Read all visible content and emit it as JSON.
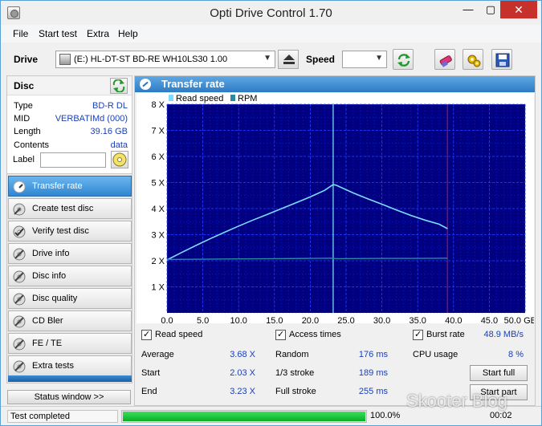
{
  "window": {
    "title": "Opti Drive Control 1.70",
    "minimize": "—",
    "maximize": "▢",
    "close": "✕"
  },
  "menu": [
    "File",
    "Start test",
    "Extra",
    "Help"
  ],
  "toolbar": {
    "drive_label": "Drive",
    "drive_value": "(E:)  HL-DT-ST BD-RE  WH10LS30 1.00",
    "speed_label": "Speed",
    "speed_value": ""
  },
  "disc": {
    "title": "Disc",
    "rows": [
      {
        "key": "Type",
        "value": "BD-R DL"
      },
      {
        "key": "MID",
        "value": "VERBATIMd (000)"
      },
      {
        "key": "Length",
        "value": "39.16 GB"
      },
      {
        "key": "Contents",
        "value": "data"
      }
    ],
    "label_key": "Label",
    "label_value": ""
  },
  "nav": {
    "items": [
      "Transfer rate",
      "Create test disc",
      "Verify test disc",
      "Drive info",
      "Disc info",
      "Disc quality",
      "CD Bler",
      "FE / TE",
      "Extra tests"
    ],
    "active_index": 0,
    "status_window": "Status window >>"
  },
  "panel": {
    "title": "Transfer rate"
  },
  "chart_data": {
    "type": "line",
    "legend": [
      "Read speed",
      "RPM"
    ],
    "x_ticks": [
      "0.0",
      "5.0",
      "10.0",
      "15.0",
      "20.0",
      "25.0",
      "30.0",
      "35.0",
      "40.0",
      "45.0",
      "50.0 GB"
    ],
    "y_ticks": [
      "1 X",
      "2 X",
      "3 X",
      "4 X",
      "5 X",
      "6 X",
      "7 X",
      "8 X"
    ],
    "xlim": [
      0,
      50
    ],
    "ylim": [
      0,
      8
    ],
    "x_unit": "GB",
    "grid": true,
    "series": [
      {
        "name": "Read speed",
        "points": [
          [
            0,
            2.03
          ],
          [
            2,
            2.31
          ],
          [
            4,
            2.58
          ],
          [
            6,
            2.84
          ],
          [
            8,
            3.09
          ],
          [
            10,
            3.33
          ],
          [
            12,
            3.56
          ],
          [
            14,
            3.78
          ],
          [
            16,
            4.0
          ],
          [
            18,
            4.22
          ],
          [
            20,
            4.45
          ],
          [
            22,
            4.7
          ],
          [
            23.2,
            4.92
          ],
          [
            23.6,
            4.9
          ],
          [
            26,
            4.6
          ],
          [
            28,
            4.38
          ],
          [
            30,
            4.17
          ],
          [
            32,
            3.95
          ],
          [
            34,
            3.74
          ],
          [
            36,
            3.56
          ],
          [
            38,
            3.4
          ],
          [
            39.16,
            3.23
          ]
        ]
      },
      {
        "name": "RPM",
        "points": [
          [
            0,
            2.05
          ],
          [
            5,
            2.06
          ],
          [
            10,
            2.07
          ],
          [
            15,
            2.08
          ],
          [
            20,
            2.09
          ],
          [
            23.2,
            2.1
          ],
          [
            23.6,
            2.08
          ],
          [
            30,
            2.09
          ],
          [
            35,
            2.09
          ],
          [
            39.16,
            2.1
          ]
        ]
      }
    ],
    "layer_break_x": 23.2,
    "disc_end_x": 39.16,
    "colors": {
      "background": "#000080",
      "grid": "#2040ff",
      "read_speed": "#7fdcff",
      "rpm": "#2a8aa0",
      "layer_break": "#7fe8ff",
      "disc_end": "#7a1550"
    }
  },
  "stats": {
    "read_speed_check": "Read speed",
    "access_times_check": "Access times",
    "burst_rate_check": "Burst rate",
    "burst_rate_value": "48.9 MB/s",
    "average_key": "Average",
    "average_value": "3.68 X",
    "start_key": "Start",
    "start_value": "2.03 X",
    "end_key": "End",
    "end_value": "3.23 X",
    "random_key": "Random",
    "random_value": "176 ms",
    "third_key": "1/3 stroke",
    "third_value": "189 ms",
    "full_key": "Full stroke",
    "full_value": "255 ms",
    "cpu_key": "CPU usage",
    "cpu_value": "8 %",
    "start_full": "Start full",
    "start_part": "Start part"
  },
  "status": {
    "text": "Test completed",
    "progress": 1.0,
    "progress_text": "100.0%",
    "time": "00:02"
  },
  "watermark": "Skooter Blog"
}
